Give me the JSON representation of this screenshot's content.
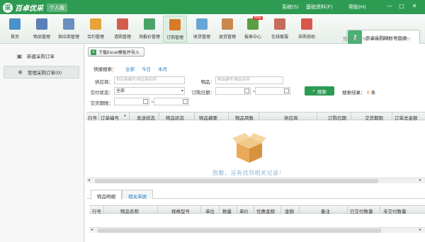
{
  "app": {
    "title": "百卓优采",
    "edition": "个人版"
  },
  "sysmenu": {
    "system": "系统(S)",
    "basic": "基础资料(F)",
    "help": "帮助(H)"
  },
  "window_controls": {
    "minimize": "—",
    "maximize": "□",
    "close": "✕"
  },
  "toolbar": {
    "items": [
      {
        "label": "首页",
        "icon": "home-icon",
        "color": "#4a90c9"
      },
      {
        "label": "物品管理",
        "icon": "goods-icon",
        "color": "#5b7fb6"
      },
      {
        "label": "供应商管理",
        "icon": "supplier-icon",
        "color": "#6b8fbf"
      },
      {
        "label": "合约管理",
        "icon": "contract-icon",
        "color": "#e7a33a"
      },
      {
        "label": "请购管理",
        "icon": "request-icon",
        "color": "#d35d4b"
      },
      {
        "label": "询报价管理",
        "icon": "quote-icon",
        "color": "#4aa36a"
      },
      {
        "label": "订购管理",
        "icon": "order-icon",
        "color": "#d97a2a"
      },
      {
        "label": "收货管理",
        "icon": "receive-icon",
        "color": "#6aa6d5"
      },
      {
        "label": "退货管理",
        "icon": "return-icon",
        "color": "#c9884d"
      },
      {
        "label": "报表中心",
        "icon": "report-icon",
        "color": "#5c9e45",
        "badge": "New"
      },
      {
        "label": "在线客服",
        "icon": "service-icon",
        "color": "#c86d5b"
      },
      {
        "label": "采购协助",
        "icon": "assist-icon",
        "color": "#d8584d"
      }
    ],
    "login_button": "百卓采购网帐号登录",
    "login_hint": "登录后发布询价单到百卓网，收取报价！"
  },
  "sidebar": {
    "items": [
      {
        "label": "新建采购订单",
        "icon": "new-order-icon"
      },
      {
        "label": "管理采购订单(0)",
        "icon": "manage-order-icon"
      }
    ]
  },
  "main": {
    "import_button": "下载Excel模板并导入",
    "quick_search": {
      "label": "快捷搜索：",
      "all": "全部",
      "today": "今日",
      "month": "本月"
    },
    "filters": {
      "supplier_label": "供应商：",
      "supplier_placeholder": "供应商编号/供应商名称",
      "goods_label": "物品：",
      "goods_placeholder": "物品编号/物品名称",
      "delivery_status_label": "交付状态：",
      "delivery_status_value": "全部",
      "order_date_label": "订购日期：",
      "due_date_label": "交货期限：",
      "range_sep": "~"
    },
    "search_button": "搜索",
    "result": {
      "label": "搜索结果：",
      "count": "0",
      "unit": "条"
    },
    "grid_columns": [
      "行号",
      "订单编号",
      "发送状态",
      "物品状态",
      "物品摘要",
      "物品项数",
      "供应商",
      "订购日期",
      "交货期限",
      "订单总金额"
    ],
    "empty_message": "抱歉，没有找到相关记录！",
    "tabs": [
      "物品明细",
      "相关单据"
    ],
    "detail_columns": [
      "行号",
      "物品名称",
      "规格型号",
      "单位",
      "数量",
      "单价",
      "优惠金额",
      "金额",
      "备注",
      "已交付数量",
      "未交付数量"
    ]
  },
  "colors": {
    "brand": "#2e9b52",
    "link": "#2a7fbf",
    "count": "#e06a1c"
  }
}
